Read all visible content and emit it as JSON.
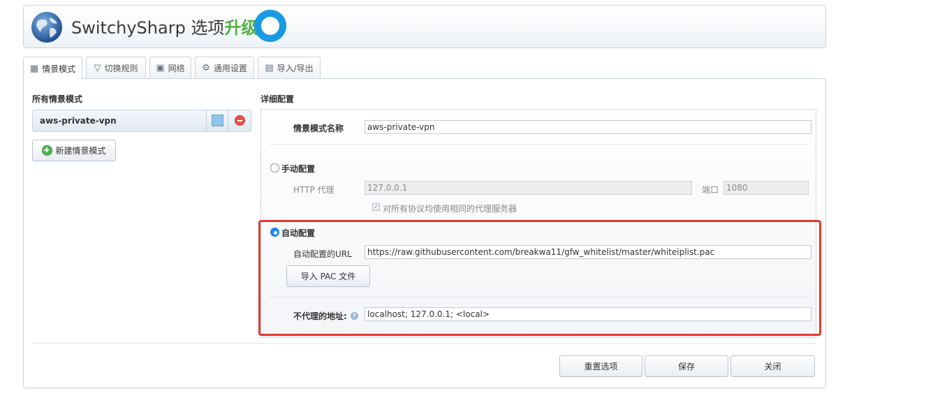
{
  "header": {
    "app_name": "SwitchySharp 选项",
    "upgrade_label": "升级",
    "logo_icon": "globe-icon"
  },
  "tabs": [
    {
      "label": "情景模式",
      "icon": "profile-icon",
      "active": true
    },
    {
      "label": "切换规则",
      "icon": "filter-icon",
      "active": false
    },
    {
      "label": "网络",
      "icon": "network-icon",
      "active": false
    },
    {
      "label": "通用设置",
      "icon": "gear-icon",
      "active": false
    },
    {
      "label": "导入/导出",
      "icon": "save-icon",
      "active": false
    }
  ],
  "left": {
    "title": "所有情景模式",
    "profiles": [
      {
        "name": "aws-private-vpn",
        "color": "#8fc6ea"
      }
    ],
    "new_profile_label": "新建情景模式"
  },
  "detail": {
    "title": "详细配置",
    "profile_name_label": "情景模式名称",
    "profile_name_value": "aws-private-vpn",
    "manual": {
      "label": "手动配置",
      "checked": false,
      "http_proxy_label": "HTTP 代理",
      "http_proxy_value": "127.0.0.1",
      "port_label": "端口",
      "port_value": "1080",
      "same_proxy_label": "对所有协议均使用相同的代理服务器",
      "same_proxy_checked": true
    },
    "auto": {
      "label": "自动配置",
      "checked": true,
      "url_label": "自动配置的URL",
      "url_value": "https://raw.githubusercontent.com/breakwa11/gfw_whitelist/master/whiteiplist.pac",
      "import_pac_label": "导入 PAC 文件"
    },
    "bypass_label": "不代理的地址:",
    "bypass_value": "localhost; 127.0.0.1; <local>",
    "highlight_color": "#e23a2e"
  },
  "footer": {
    "reset_label": "重置选项",
    "save_label": "保存",
    "close_label": "关闭"
  }
}
